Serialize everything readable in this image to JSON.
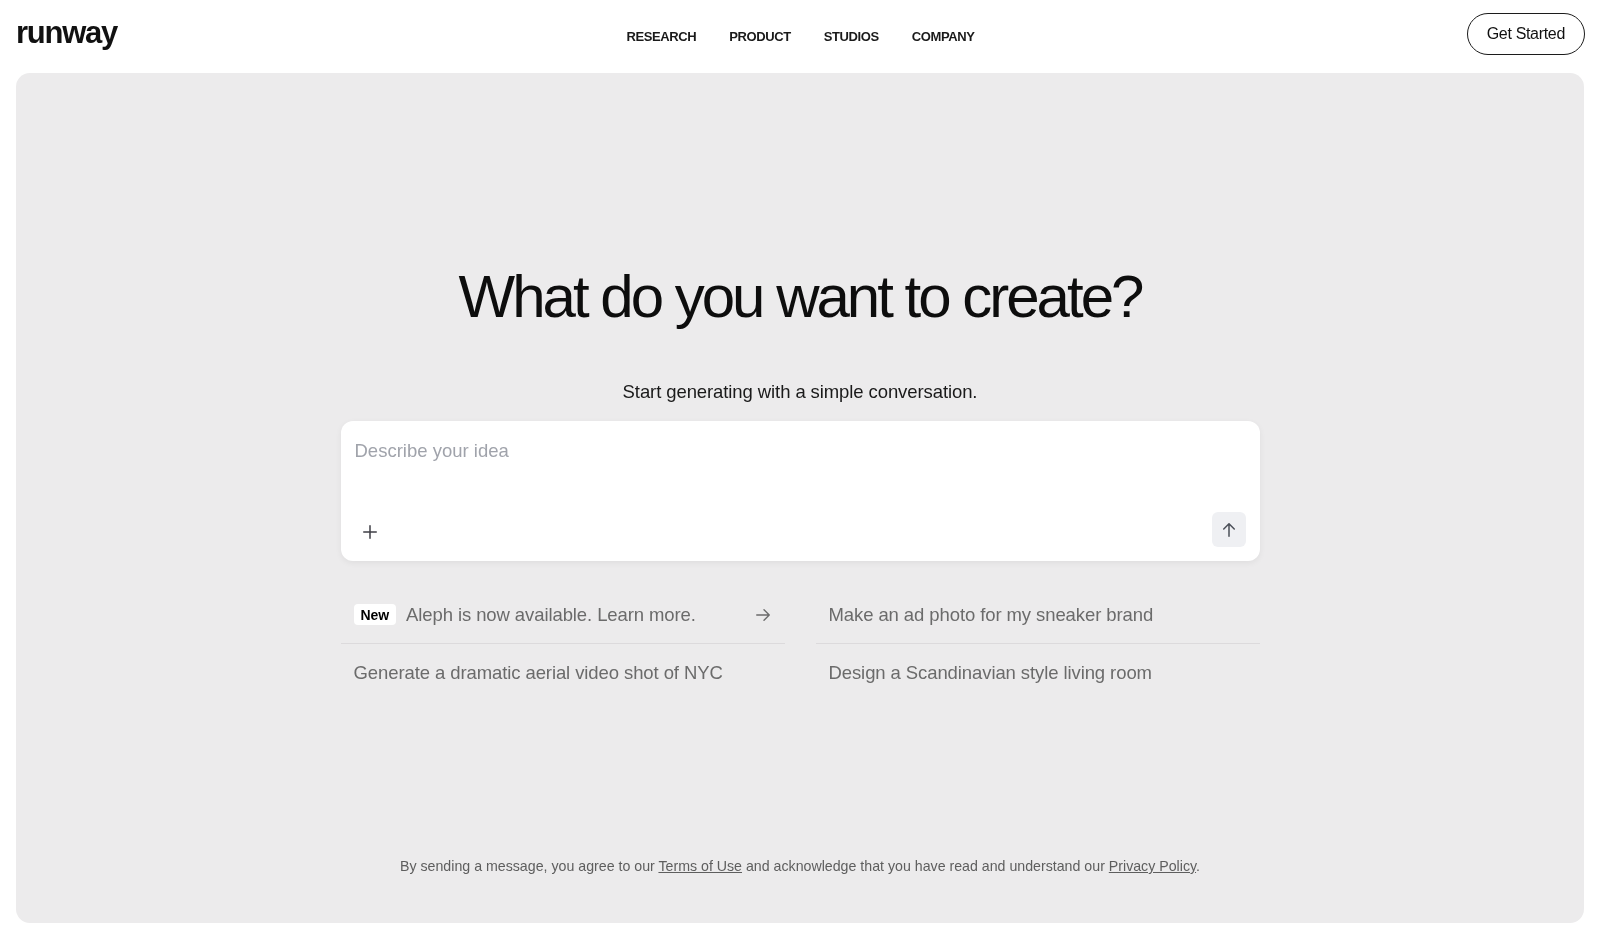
{
  "header": {
    "logo": "runway",
    "nav": [
      "RESEARCH",
      "PRODUCT",
      "STUDIOS",
      "COMPANY"
    ],
    "cta": "Get Started"
  },
  "hero": {
    "title": "What do you want to create?",
    "subtitle": "Start generating with a simple conversation."
  },
  "prompt": {
    "placeholder": "Describe your idea"
  },
  "suggestions": [
    {
      "kind": "announcement",
      "badge": "New",
      "text": "Aleph is now available. Learn more."
    },
    {
      "kind": "prompt",
      "text": "Make an ad photo for my sneaker brand"
    },
    {
      "kind": "prompt",
      "text": "Generate a dramatic aerial video shot of NYC"
    },
    {
      "kind": "prompt",
      "text": "Design a Scandinavian style living room"
    }
  ],
  "footer": {
    "notice": [
      {
        "kind": "text",
        "text": "By sending a message, you agree to our "
      },
      {
        "kind": "link",
        "text": "Terms of Use"
      },
      {
        "kind": "text",
        "text": " and acknowledge that you have read and understand our "
      },
      {
        "kind": "link",
        "text": "Privacy Policy"
      },
      {
        "kind": "text",
        "text": "."
      }
    ]
  }
}
